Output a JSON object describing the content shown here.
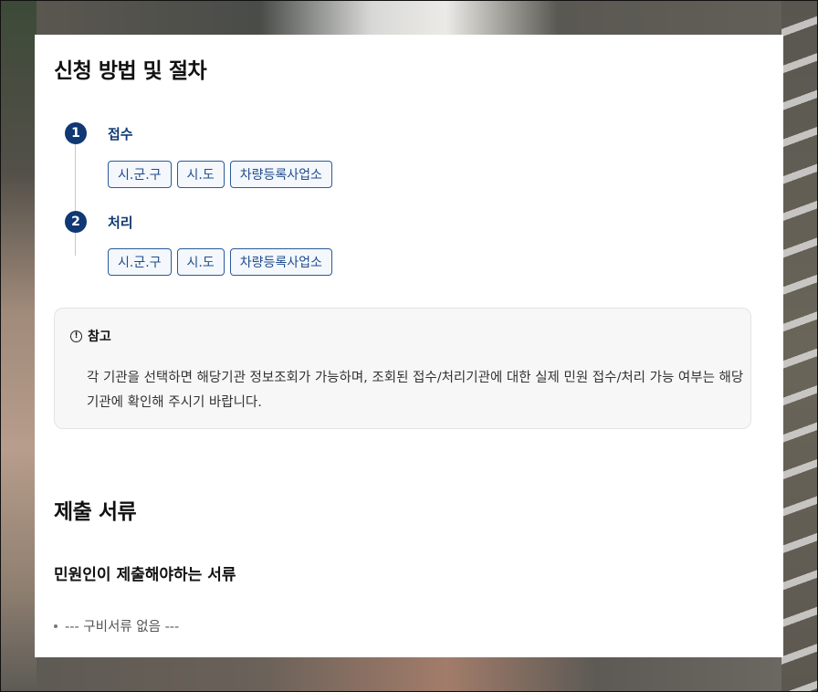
{
  "procedure": {
    "title": "신청 방법 및 절차",
    "steps": [
      {
        "number": "1",
        "label": "접수",
        "chips": [
          "시.군.구",
          "시.도",
          "차량등록사업소"
        ]
      },
      {
        "number": "2",
        "label": "처리",
        "chips": [
          "시.군.구",
          "시.도",
          "차량등록사업소"
        ]
      }
    ]
  },
  "note": {
    "icon": "info-circle-icon",
    "title": "참고",
    "body": "각 기관을 선택하면 해당기관 정보조회가 가능하며, 조회된 접수/처리기관에 대한 실제 민원 접수/처리 가능 여부는 해당기관에 확인해 주시기 바랍니다."
  },
  "documents": {
    "title": "제출 서류",
    "subtitle": "민원인이 제출해야하는 서류",
    "items": [
      "--- 구비서류 없음 ---"
    ]
  },
  "colors": {
    "accent": "#0f3874",
    "chip_border": "#2b5a9a"
  }
}
